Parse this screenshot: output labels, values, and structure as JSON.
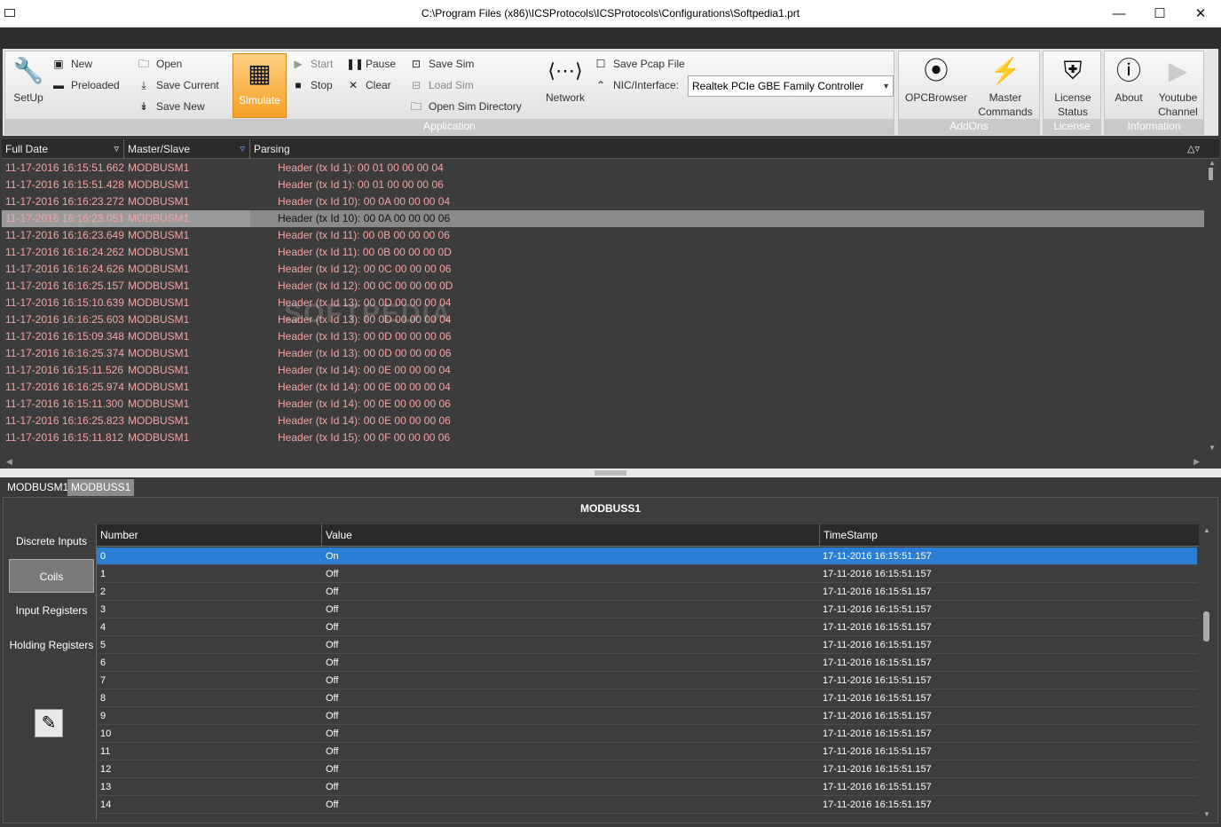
{
  "window": {
    "title": "C:\\Program Files (x86)\\ICSProtocols\\ICSProtocols\\Configurations\\Softpedia1.prt",
    "minimize": "—",
    "maximize": "☐",
    "close": "✕"
  },
  "ribbon": {
    "setup": "SetUp",
    "new": "New",
    "preloaded": "Preloaded",
    "open": "Open",
    "save_current": "Save Current",
    "save_new": "Save New",
    "simulate": "Simulate",
    "start": "Start",
    "stop": "Stop",
    "pause": "Pause",
    "clear": "Clear",
    "save_sim": "Save Sim",
    "load_sim": "Load Sim",
    "open_sim_directory": "Open Sim Directory",
    "network": "Network",
    "save_pcap_file": "Save Pcap File",
    "nic_interface_label": "NIC/Interface:",
    "nic_interface_value": "Realtek PCIe GBE Family Controller",
    "application_group": "Application",
    "opc_browser": "OPCBrowser",
    "master_commands_1": "Master",
    "master_commands_2": "Commands",
    "addons_group": "AddOns",
    "license_status_1": "License",
    "license_status_2": "Status",
    "license_group": "License",
    "about": "About",
    "youtube_1": "Youtube",
    "youtube_2": "Channel",
    "information_group": "Information"
  },
  "log": {
    "columns": [
      "Full Date",
      "Master/Slave",
      "Parsing"
    ],
    "watermark": "SOFTPEDIA",
    "rows": [
      [
        "11-17-2016 16:15:51.662",
        "MODBUSM1",
        "Header (tx Id 1): 00 01 00 00 00 04"
      ],
      [
        "11-17-2016 16:15:51.428",
        "MODBUSM1",
        "Header (tx Id 1): 00 01 00 00 00 06"
      ],
      [
        "11-17-2016 16:16:23.272",
        "MODBUSM1",
        "Header (tx Id 10): 00 0A 00 00 00 04"
      ],
      [
        "11-17-2016 16:16:23.051",
        "MODBUSM1",
        "Header (tx Id 10): 00 0A 00 00 00 06"
      ],
      [
        "11-17-2016 16:16:23.649",
        "MODBUSM1",
        "Header (tx Id 11): 00 0B 00 00 00 06"
      ],
      [
        "11-17-2016 16:16:24.262",
        "MODBUSM1",
        "Header (tx Id 11): 00 0B 00 00 00 0D"
      ],
      [
        "11-17-2016 16:16:24.626",
        "MODBUSM1",
        "Header (tx Id 12): 00 0C 00 00 00 06"
      ],
      [
        "11-17-2016 16:16:25.157",
        "MODBUSM1",
        "Header (tx Id 12): 00 0C 00 00 00 0D"
      ],
      [
        "11-17-2016 16:15:10.639",
        "MODBUSM1",
        "Header (tx Id 13): 00 0D 00 00 00 04"
      ],
      [
        "11-17-2016 16:16:25.603",
        "MODBUSM1",
        "Header (tx Id 13): 00 0D 00 00 00 04"
      ],
      [
        "11-17-2016 16:15:09.348",
        "MODBUSM1",
        "Header (tx Id 13): 00 0D 00 00 00 06"
      ],
      [
        "11-17-2016 16:16:25.374",
        "MODBUSM1",
        "Header (tx Id 13): 00 0D 00 00 00 06"
      ],
      [
        "11-17-2016 16:15:11.526",
        "MODBUSM1",
        "Header (tx Id 14): 00 0E 00 00 00 04"
      ],
      [
        "11-17-2016 16:16:25.974",
        "MODBUSM1",
        "Header (tx Id 14): 00 0E 00 00 00 04"
      ],
      [
        "11-17-2016 16:15:11.300",
        "MODBUSM1",
        "Header (tx Id 14): 00 0E 00 00 00 06"
      ],
      [
        "11-17-2016 16:16:25.823",
        "MODBUSM1",
        "Header (tx Id 14): 00 0E 00 00 00 06"
      ],
      [
        "11-17-2016 16:15:11.812",
        "MODBUSM1",
        "Header (tx Id 15): 00 0F 00 00 00 06"
      ]
    ],
    "selected_row": 3
  },
  "tabs": [
    "MODBUSM1",
    "MODBUSS1"
  ],
  "active_tab": 1,
  "panel": {
    "title": "MODBUSS1",
    "side_buttons": [
      "Discrete Inputs",
      "Coils",
      "Input Registers",
      "Holding Registers"
    ],
    "active_side_button": 1,
    "columns": [
      "Number",
      "Value",
      "TimeStamp"
    ],
    "rows": [
      [
        "0",
        "On",
        "17-11-2016 16:15:51.157"
      ],
      [
        "1",
        "Off",
        "17-11-2016 16:15:51.157"
      ],
      [
        "2",
        "Off",
        "17-11-2016 16:15:51.157"
      ],
      [
        "3",
        "Off",
        "17-11-2016 16:15:51.157"
      ],
      [
        "4",
        "Off",
        "17-11-2016 16:15:51.157"
      ],
      [
        "5",
        "Off",
        "17-11-2016 16:15:51.157"
      ],
      [
        "6",
        "Off",
        "17-11-2016 16:15:51.157"
      ],
      [
        "7",
        "Off",
        "17-11-2016 16:15:51.157"
      ],
      [
        "8",
        "Off",
        "17-11-2016 16:15:51.157"
      ],
      [
        "9",
        "Off",
        "17-11-2016 16:15:51.157"
      ],
      [
        "10",
        "Off",
        "17-11-2016 16:15:51.157"
      ],
      [
        "11",
        "Off",
        "17-11-2016 16:15:51.157"
      ],
      [
        "12",
        "Off",
        "17-11-2016 16:15:51.157"
      ],
      [
        "13",
        "Off",
        "17-11-2016 16:15:51.157"
      ],
      [
        "14",
        "Off",
        "17-11-2016 16:15:51.157"
      ]
    ],
    "selected_row": 0
  },
  "colors": {
    "log_text": "#f3a3a3",
    "selection_blue": "#2a7fd4",
    "simulate_orange": "#f5a128"
  }
}
